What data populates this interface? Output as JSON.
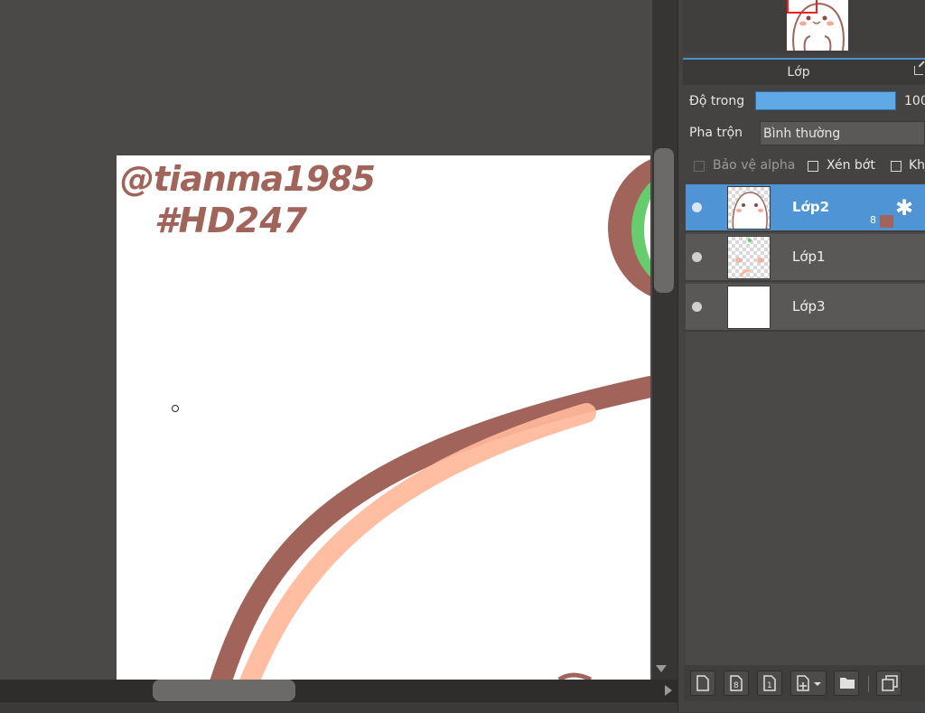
{
  "canvas": {
    "watermark_line1": "@tianma1985",
    "watermark_line2": "#HD247",
    "colors": {
      "outline": "#a0645a",
      "fill": "#ffb79a",
      "green": "#66cc6e",
      "canvas": "#ffffff"
    }
  },
  "layer_panel": {
    "title": "Lớp",
    "opacity_label": "Độ trong",
    "opacity_value": "100",
    "opacity_fraction": 1.0,
    "blend_label": "Pha trộn",
    "blend_value": "Bình thường",
    "protect_alpha_label": "Bảo vệ alpha",
    "clipping_label": "Xén bớt",
    "lock_label": "Kh",
    "accent_color": "#4f94d4"
  },
  "layers": [
    {
      "name": "Lớp2",
      "selected": true,
      "bit_depth": "8",
      "thumbnail": "character"
    },
    {
      "name": "Lớp1",
      "selected": false,
      "thumbnail": "transparent"
    },
    {
      "name": "Lớp3",
      "selected": false,
      "thumbnail": "white"
    }
  ],
  "toolbar_icons": [
    "new-layer-icon",
    "new-8bit-layer-icon",
    "new-1bit-layer-icon",
    "add-layer-menu-icon",
    "folder-icon",
    "duplicate-layer-icon"
  ]
}
